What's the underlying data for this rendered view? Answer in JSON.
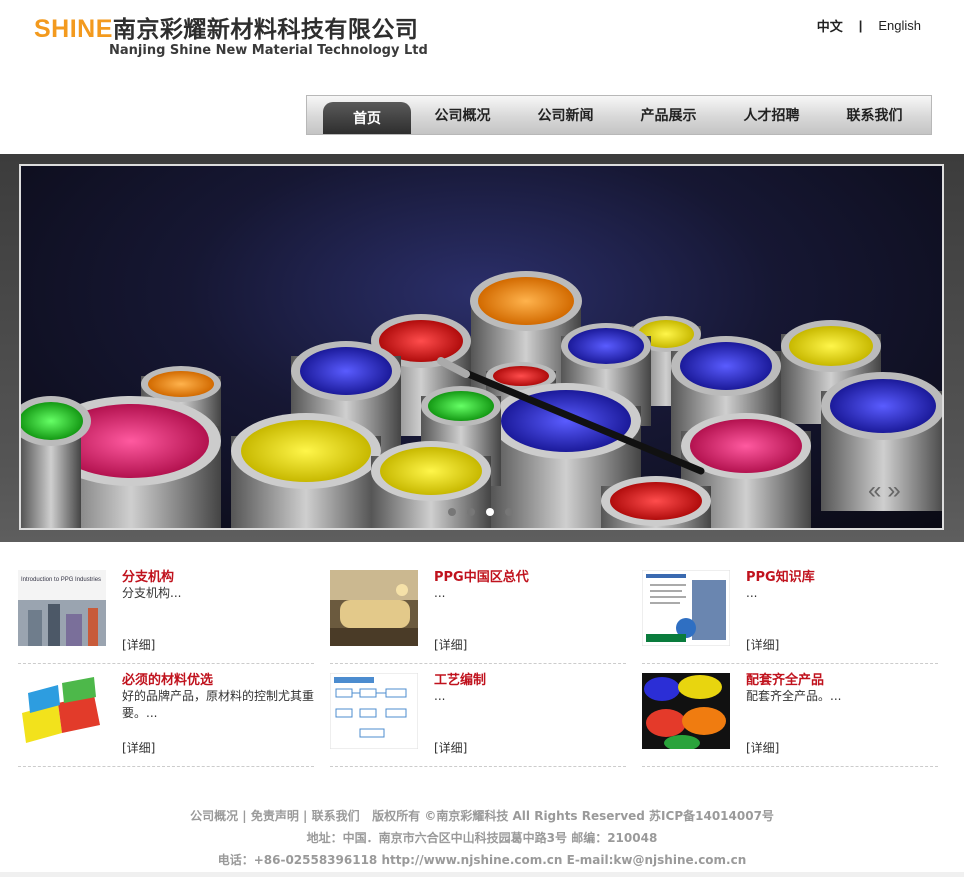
{
  "logo": {
    "shine": "SHINE",
    "cn_name": "南京彩耀新材料科技有限公司",
    "en_name": "Nanjing Shine New Material Technology Ltd"
  },
  "lang": {
    "cn": "中文",
    "separator": "|",
    "en": "English"
  },
  "nav": {
    "items": [
      {
        "label": "首页"
      },
      {
        "label": "公司概况"
      },
      {
        "label": "公司新闻"
      },
      {
        "label": "产品展示"
      },
      {
        "label": "人才招聘"
      },
      {
        "label": "联系我们"
      }
    ]
  },
  "banner": {
    "active_slide": 3,
    "slide_count": 4
  },
  "cards": [
    {
      "title": "分支机构",
      "desc": "分支机构...",
      "more": "[详细]",
      "thumb_icon": "ppg-intro-thumbnail"
    },
    {
      "title": "PPG中国区总代",
      "desc": "...",
      "more": "[详细]",
      "thumb_icon": "office-reception-thumbnail"
    },
    {
      "title": "PPG知识库",
      "desc": "...",
      "more": "[详细]",
      "thumb_icon": "document-thumbnail"
    },
    {
      "title": "必须的材料优选",
      "desc": "好的品牌产品，原材料的控制尤其重要。...",
      "more": "[详细]",
      "thumb_icon": "puzzle-thumbnail"
    },
    {
      "title": "工艺编制",
      "desc": "...",
      "more": "[详细]",
      "thumb_icon": "flowchart-thumbnail"
    },
    {
      "title": "配套齐全产品",
      "desc": "配套齐全产品。...",
      "more": "[详细]",
      "thumb_icon": "paint-cans-thumbnail"
    }
  ],
  "footer": {
    "links": [
      "公司概况",
      "免责声明",
      "联系我们"
    ],
    "copyright": "版权所有 ©南京彩耀科技 All Rights Reserved 苏ICP备14014007号",
    "address": "地址：中国．南京市六合区中山科技园葛中路3号 邮编：210048",
    "contact": "电话：+86-02558396118 http://www.njshine.com.cn E-mail:kw@njshine.com.cn"
  },
  "colors": {
    "accent_red": "#c0121d",
    "logo_orange": "#f39a1e"
  }
}
